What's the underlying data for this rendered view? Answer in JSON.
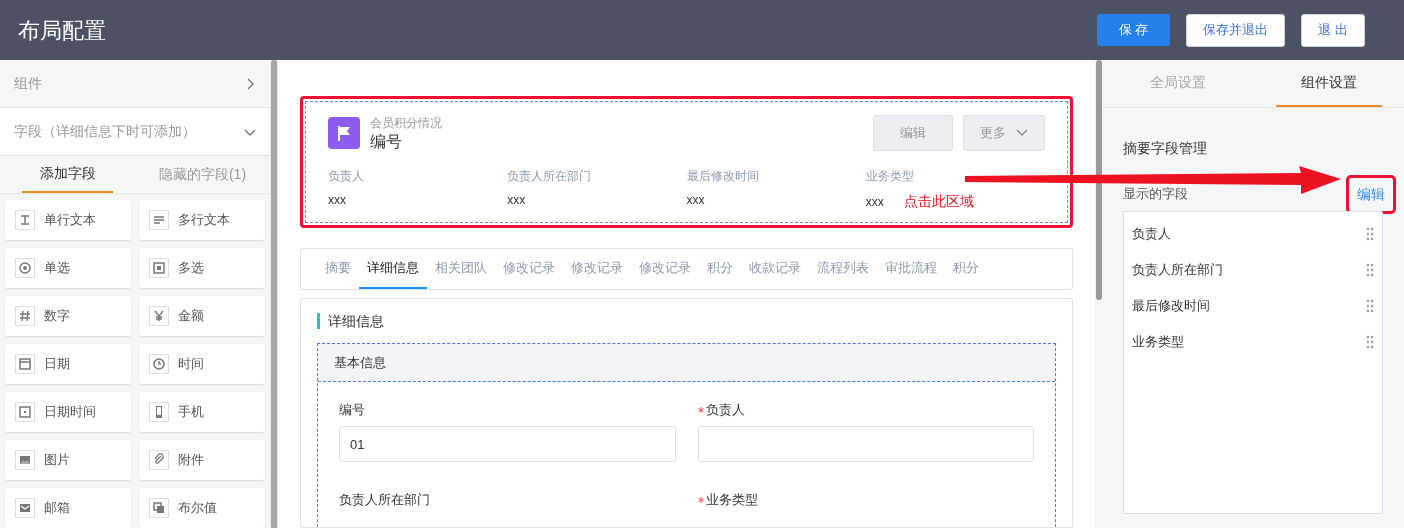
{
  "header": {
    "title": "布局配置",
    "buttons": [
      {
        "label": "保 存",
        "kind": "primary"
      },
      {
        "label": "保存并退出",
        "kind": "default"
      },
      {
        "label": "退 出",
        "kind": "default"
      }
    ]
  },
  "left_panel": {
    "sections": [
      {
        "label": "组件",
        "expanded": false
      },
      {
        "label": "字段（详细信息下时可添加）",
        "expanded": true
      }
    ],
    "tabs": [
      {
        "label": "添加字段",
        "selected": true
      },
      {
        "label": "隐藏的字段(1)",
        "selected": false
      }
    ],
    "fields": [
      "单行文本",
      "多行文本",
      "单选",
      "多选",
      "数字",
      "金额",
      "日期",
      "时间",
      "日期时间",
      "手机",
      "图片",
      "附件",
      "邮箱",
      "布尔值"
    ]
  },
  "summary_card": {
    "subtitle": "会员积分情况",
    "title": "编号",
    "buttons": [
      "编辑",
      "更多"
    ],
    "fields": [
      {
        "label": "负责人",
        "value": "xxx"
      },
      {
        "label": "负责人所在部门",
        "value": "xxx"
      },
      {
        "label": "最后修改时间",
        "value": "xxx"
      },
      {
        "label": "业务类型",
        "value": "xxx"
      }
    ],
    "annotation": "点击此区域"
  },
  "detail_tabs": [
    {
      "label": "摘要",
      "selected": false
    },
    {
      "label": "详细信息",
      "selected": true
    },
    {
      "label": "相关团队",
      "selected": false
    },
    {
      "label": "修改记录",
      "selected": false
    },
    {
      "label": "修改记录",
      "selected": false
    },
    {
      "label": "修改记录",
      "selected": false
    },
    {
      "label": "积分",
      "selected": false
    },
    {
      "label": "收款记录",
      "selected": false
    },
    {
      "label": "流程列表",
      "selected": false
    },
    {
      "label": "审批流程",
      "selected": false
    },
    {
      "label": "积分",
      "selected": false
    }
  ],
  "detail": {
    "title": "详细信息",
    "group": "基本信息",
    "form_fields": [
      {
        "label": "编号",
        "required": false,
        "kind": "input",
        "value": "01"
      },
      {
        "label": "负责人",
        "required": true,
        "kind": "input"
      },
      {
        "label": "负责人所在部门",
        "required": false,
        "kind": "label"
      },
      {
        "label": "业务类型",
        "required": true,
        "kind": "label"
      }
    ]
  },
  "right_panel": {
    "tabs": [
      {
        "label": "全局设置",
        "selected": false
      },
      {
        "label": "组件设置",
        "selected": true
      }
    ],
    "heading": "摘要字段管理",
    "list_label": "显示的字段",
    "edit_link": "编辑",
    "shown_fields": [
      "负责人",
      "负责人所在部门",
      "最后修改时间",
      "业务类型"
    ]
  }
}
